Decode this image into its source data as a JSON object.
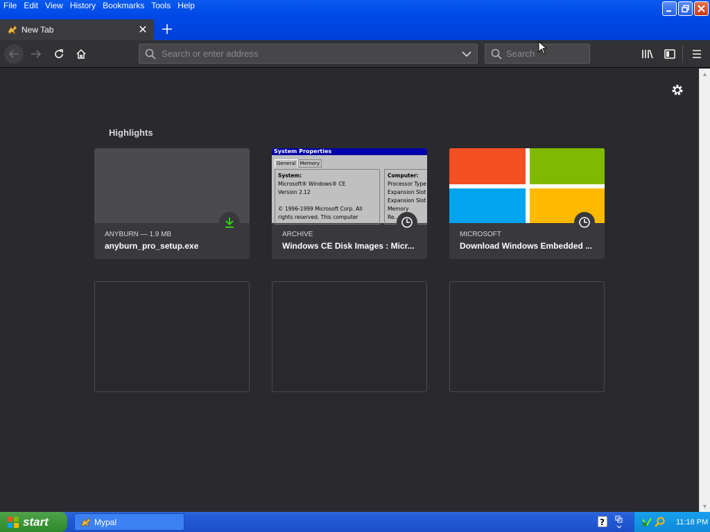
{
  "menu": [
    "File",
    "Edit",
    "View",
    "History",
    "Bookmarks",
    "Tools",
    "Help"
  ],
  "tab": {
    "label": "New Tab"
  },
  "urlbar": {
    "placeholder": "Search or enter address"
  },
  "searchbar": {
    "placeholder": "Search"
  },
  "highlights": {
    "title": "Highlights",
    "cards": [
      {
        "host": "ANYBURN — 1.9 MB",
        "title": "anyburn_pro_setup.exe",
        "badge": "download-icon"
      },
      {
        "host": "ARCHIVE",
        "title": "Windows CE Disk Images : Micr...",
        "badge": "clock-icon",
        "thumb": {
          "window_title": "System Properties",
          "tabs": [
            "General",
            "Memory"
          ],
          "system_label": "System:",
          "lines": [
            "Microsoft® Windows® CE",
            "Version 2.12",
            "",
            "© 1996-1999 Microsoft Corp. All",
            "rights reserved. This computer"
          ],
          "computer_label": "Computer:",
          "computer_lines": [
            "Processor Type",
            "Expansion Slot",
            "Expansion Slot",
            "Memory",
            "Re..."
          ]
        }
      },
      {
        "host": "MICROSOFT",
        "title": "Download Windows Embedded ...",
        "badge": "clock-icon"
      }
    ]
  },
  "taskbar": {
    "start_label": "start",
    "window_label": "Mypal",
    "time": "11:18 PM"
  },
  "colors": {
    "ms_red": "#f25022",
    "ms_green": "#7fba00",
    "ms_blue": "#00a4ef",
    "ms_yellow": "#ffb900",
    "download_green": "#30e60b"
  }
}
